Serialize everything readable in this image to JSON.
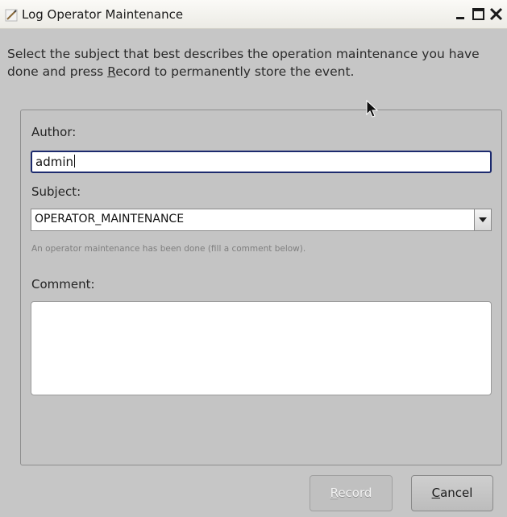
{
  "window": {
    "title": "Log Operator Maintenance",
    "icons": {
      "app": "pencil-icon",
      "minimize": "minimize-icon",
      "maximize": "maximize-icon",
      "close": "close-icon"
    }
  },
  "intro": {
    "before": "Select the subject that best describes the operation maintenance you have done and press ",
    "mnemonic": "R",
    "keyword_rest": "ecord",
    "after": " to permanently store the event."
  },
  "form": {
    "author_label": "Author:",
    "author_value": "admin",
    "subject_label": "Subject:",
    "subject_value": "OPERATOR_MAINTENANCE",
    "subject_hint": "An operator maintenance has been done (fill a comment below).",
    "comment_label": "Comment:",
    "comment_value": ""
  },
  "buttons": {
    "record": {
      "mnemonic": "R",
      "rest": "ecord",
      "enabled": false
    },
    "cancel": {
      "mnemonic": "C",
      "rest": "ancel",
      "enabled": true
    }
  },
  "colors": {
    "focus_border": "#1c2a6e",
    "background": "#c6c6c6"
  }
}
